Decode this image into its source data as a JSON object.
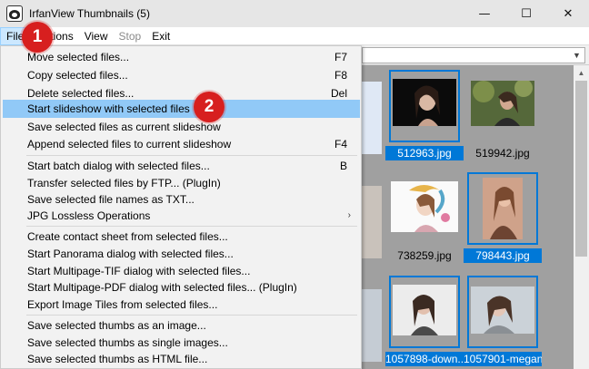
{
  "window": {
    "title": "IrfanView Thumbnails (5)",
    "minimize_glyph": "—",
    "maximize_glyph": "☐",
    "close_glyph": "✕"
  },
  "menubar": {
    "items": [
      {
        "label": "File",
        "state": "active"
      },
      {
        "label": "Options",
        "state": "normal"
      },
      {
        "label": "View",
        "state": "normal"
      },
      {
        "label": "Stop",
        "state": "disabled"
      },
      {
        "label": "Exit",
        "state": "normal"
      }
    ]
  },
  "file_menu": {
    "items": [
      {
        "label": "Move selected files...",
        "shortcut": "F7"
      },
      {
        "label": "Copy selected files...",
        "shortcut": "F8"
      },
      {
        "label": "Delete selected files...",
        "shortcut": "Del"
      },
      {
        "label": "Start slideshow with selected files",
        "shortcut": "",
        "highlighted": true
      },
      {
        "label": "Save selected files as current slideshow",
        "shortcut": ""
      },
      {
        "label": "Append selected files to current slideshow",
        "shortcut": "F4"
      },
      {
        "label": "Start batch dialog with selected files...",
        "shortcut": "B"
      },
      {
        "label": "Transfer selected files by FTP... (PlugIn)",
        "shortcut": ""
      },
      {
        "label": "Save selected file names as TXT...",
        "shortcut": ""
      },
      {
        "label": "JPG Lossless Operations",
        "shortcut": "",
        "submenu": true
      },
      {
        "label": "Create contact sheet from selected files...",
        "shortcut": ""
      },
      {
        "label": "Start Panorama dialog with selected files...",
        "shortcut": ""
      },
      {
        "label": "Start Multipage-TIF dialog with selected files...",
        "shortcut": ""
      },
      {
        "label": "Start Multipage-PDF dialog with selected files... (PlugIn)",
        "shortcut": ""
      },
      {
        "label": "Export Image Tiles from selected files...",
        "shortcut": ""
      },
      {
        "label": "Save selected thumbs as an image...",
        "shortcut": ""
      },
      {
        "label": "Save selected thumbs as single images...",
        "shortcut": ""
      },
      {
        "label": "Save selected thumbs as HTML file...",
        "shortcut": ""
      }
    ],
    "submenu_glyph": "›"
  },
  "thumbnails": [
    {
      "label": "512963.jpg",
      "selected": true
    },
    {
      "label": "519942.jpg",
      "selected": false
    },
    {
      "label": "738259.jpg",
      "selected": false
    },
    {
      "label": "798443.jpg",
      "selected": true
    },
    {
      "label": "1057898-down...",
      "selected": true
    },
    {
      "label": "1057901-megan",
      "selected": true
    }
  ],
  "combo": {
    "arrow_glyph": "▼"
  },
  "scrollbar": {
    "up_glyph": "▲"
  },
  "badges": [
    {
      "label": "1"
    },
    {
      "label": "2"
    }
  ],
  "colors": {
    "selection_blue": "#0078d7",
    "menu_highlight": "#91c9f7",
    "badge_red": "#d71f1f"
  }
}
